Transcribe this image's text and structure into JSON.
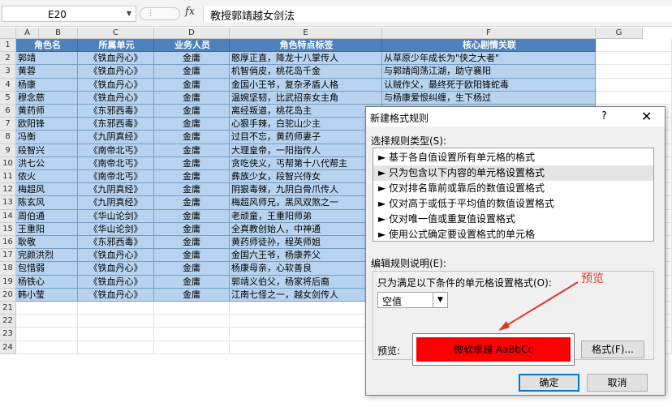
{
  "formula_bar": {
    "name_box": "E20",
    "fx": "fx",
    "content": "教授郭靖越女剑法"
  },
  "columns": [
    "A",
    "B",
    "C",
    "D",
    "E",
    "F",
    "G"
  ],
  "rows": [
    "1",
    "2",
    "3",
    "4",
    "5",
    "6",
    "7",
    "8",
    "9",
    "10",
    "11",
    "12",
    "13",
    "14",
    "15",
    "16",
    "17",
    "18",
    "19",
    "20",
    "21",
    "22",
    "23",
    "24"
  ],
  "table": {
    "headers": [
      "角色名",
      "所属单元",
      "业务人员",
      "角色特点标签",
      "核心剧情关联"
    ],
    "rows": [
      [
        "郭靖",
        "《铁血丹心》",
        "金庸",
        "憨厚正直，降龙十八掌传人",
        "从草原少年成长为\"侠之大者\""
      ],
      [
        "黄蓉",
        "《铁血丹心》",
        "金庸",
        "机智俏皮，桃花岛千金",
        "与郭靖闯荡江湖，助守襄阳"
      ],
      [
        "杨康",
        "《铁血丹心》",
        "金庸",
        "金国小王爷，复杂矛盾人格",
        "认贼作父，最终死于欧阳锋蛇毒"
      ],
      [
        "穆念慈",
        "《铁血丹心》",
        "金庸",
        "温婉坚韧，比武招亲女主角",
        "与杨康爱恨纠缠，生下杨过"
      ],
      [
        "黄药师",
        "《东邪西毒》",
        "金庸",
        "离经叛道，桃花岛主",
        ""
      ],
      [
        "欧阳锋",
        "《东邪西毒》",
        "金庸",
        "心狠手辣，白驼山少主",
        ""
      ],
      [
        "冯衡",
        "《九阴真经》",
        "金庸",
        "过目不忘，黄药师妻子",
        ""
      ],
      [
        "段智兴",
        "《南帝北丐》",
        "金庸",
        "大理皇帝，一阳指传人",
        ""
      ],
      [
        "洪七公",
        "《南帝北丐》",
        "金庸",
        "贪吃侠义，丐帮第十八代帮主",
        ""
      ],
      [
        "侬火",
        "《南帝北丐》",
        "金庸",
        "彝族少女，段智兴侍女",
        ""
      ],
      [
        "梅超风",
        "《九阴真经》",
        "金庸",
        "阴狠毒辣，九阴白骨爪传人",
        ""
      ],
      [
        "陈玄风",
        "《九阴真经》",
        "金庸",
        "梅超风师兄，黑风双煞之一",
        ""
      ],
      [
        "周伯通",
        "《华山论剑》",
        "金庸",
        "老顽童，王重阳师弟",
        ""
      ],
      [
        "王重阳",
        "《华山论剑》",
        "金庸",
        "全真教创始人，中神通",
        ""
      ],
      [
        "耿敬",
        "《东邪西毒》",
        "金庸",
        "黄药师徒孙，程英师姐",
        ""
      ],
      [
        "完颜洪烈",
        "《铁血丹心》",
        "金庸",
        "金国六王爷，杨康养父",
        ""
      ],
      [
        "包惜弱",
        "《铁血丹心》",
        "金庸",
        "杨康母亲，心软善良",
        ""
      ],
      [
        "杨铁心",
        "《铁血丹心》",
        "金庸",
        "郭靖义伯父，杨家将后裔",
        ""
      ],
      [
        "韩小莹",
        "《铁血丹心》",
        "金庸",
        "江南七怪之一，越女剑传人",
        ""
      ]
    ]
  },
  "dialog": {
    "title": "新建格式规则",
    "help": "?",
    "close": "✕",
    "select_type_label": "选择规则类型(S):",
    "rule_types": [
      "► 基于各自值设置所有单元格的格式",
      "► 只为包含以下内容的单元格设置格式",
      "► 仅对排名靠前或靠后的数值设置格式",
      "► 仅对高于或低于平均值的数值设置格式",
      "► 仅对唯一值或重复值设置格式",
      "► 使用公式确定要设置格式的单元格"
    ],
    "selected_index": 1,
    "edit_label": "编辑规则说明(E):",
    "condition_label": "只为满足以下条件的单元格设置格式(O):",
    "condition_value": "空值",
    "preview_label": "预览:",
    "preview_text": "微软卓越  AaBbCc",
    "preview_color": "#ff0000",
    "format_button": "格式(F)...",
    "ok_button": "确定",
    "cancel_button": "取消"
  },
  "annotation": "预览"
}
